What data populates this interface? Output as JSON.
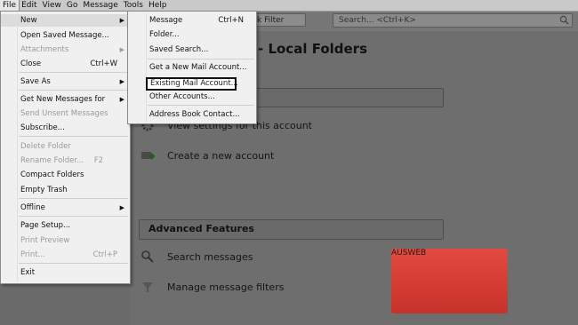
{
  "menubar": [
    "File",
    "Edit",
    "View",
    "Go",
    "Message",
    "Tools",
    "Help"
  ],
  "toolbar": {
    "quick_filter": "k Filter",
    "search_placeholder": "Search... <Ctrl+K>"
  },
  "page": {
    "title": "- Local Folders"
  },
  "account_section": {
    "view_settings": "View settings for this account",
    "create_account": "Create a new account"
  },
  "advanced": {
    "heading": "Advanced Features",
    "search": "Search messages",
    "filters": "Manage message filters"
  },
  "file_menu": [
    {
      "label": "New",
      "shortcut": "",
      "submenu": true,
      "disabled": false
    },
    {
      "label": "Open Saved Message...",
      "shortcut": "",
      "submenu": false,
      "disabled": false
    },
    {
      "label": "Attachments",
      "shortcut": "",
      "submenu": true,
      "disabled": true
    },
    {
      "label": "Close",
      "shortcut": "Ctrl+W",
      "submenu": false,
      "disabled": false
    },
    {
      "label": "Save As",
      "shortcut": "",
      "submenu": true,
      "disabled": false
    },
    {
      "label": "Get New Messages for",
      "shortcut": "",
      "submenu": true,
      "disabled": false
    },
    {
      "label": "Send Unsent Messages",
      "shortcut": "",
      "submenu": false,
      "disabled": true
    },
    {
      "label": "Subscribe...",
      "shortcut": "",
      "submenu": false,
      "disabled": false
    },
    {
      "label": "Delete Folder",
      "shortcut": "",
      "submenu": false,
      "disabled": true
    },
    {
      "label": "Rename Folder...",
      "shortcut": "F2",
      "submenu": false,
      "disabled": true
    },
    {
      "label": "Compact Folders",
      "shortcut": "",
      "submenu": false,
      "disabled": false
    },
    {
      "label": "Empty Trash",
      "shortcut": "",
      "submenu": false,
      "disabled": false
    },
    {
      "label": "Offline",
      "shortcut": "",
      "submenu": true,
      "disabled": false
    },
    {
      "label": "Page Setup...",
      "shortcut": "",
      "submenu": false,
      "disabled": false
    },
    {
      "label": "Print Preview",
      "shortcut": "",
      "submenu": false,
      "disabled": true
    },
    {
      "label": "Print...",
      "shortcut": "Ctrl+P",
      "submenu": false,
      "disabled": true
    },
    {
      "label": "Exit",
      "shortcut": "",
      "submenu": false,
      "disabled": false
    }
  ],
  "new_menu": [
    {
      "label": "Message",
      "shortcut": "Ctrl+N"
    },
    {
      "label": "Folder...",
      "shortcut": ""
    },
    {
      "label": "Saved Search...",
      "shortcut": ""
    },
    {
      "label": "Get a New Mail Account...",
      "shortcut": ""
    },
    {
      "label": "Existing Mail Account...",
      "shortcut": ""
    },
    {
      "label": "Other Accounts...",
      "shortcut": ""
    },
    {
      "label": "Address Book Contact...",
      "shortcut": ""
    }
  ],
  "logo": {
    "text": "AUSWEB",
    "color": "#d63a30"
  }
}
